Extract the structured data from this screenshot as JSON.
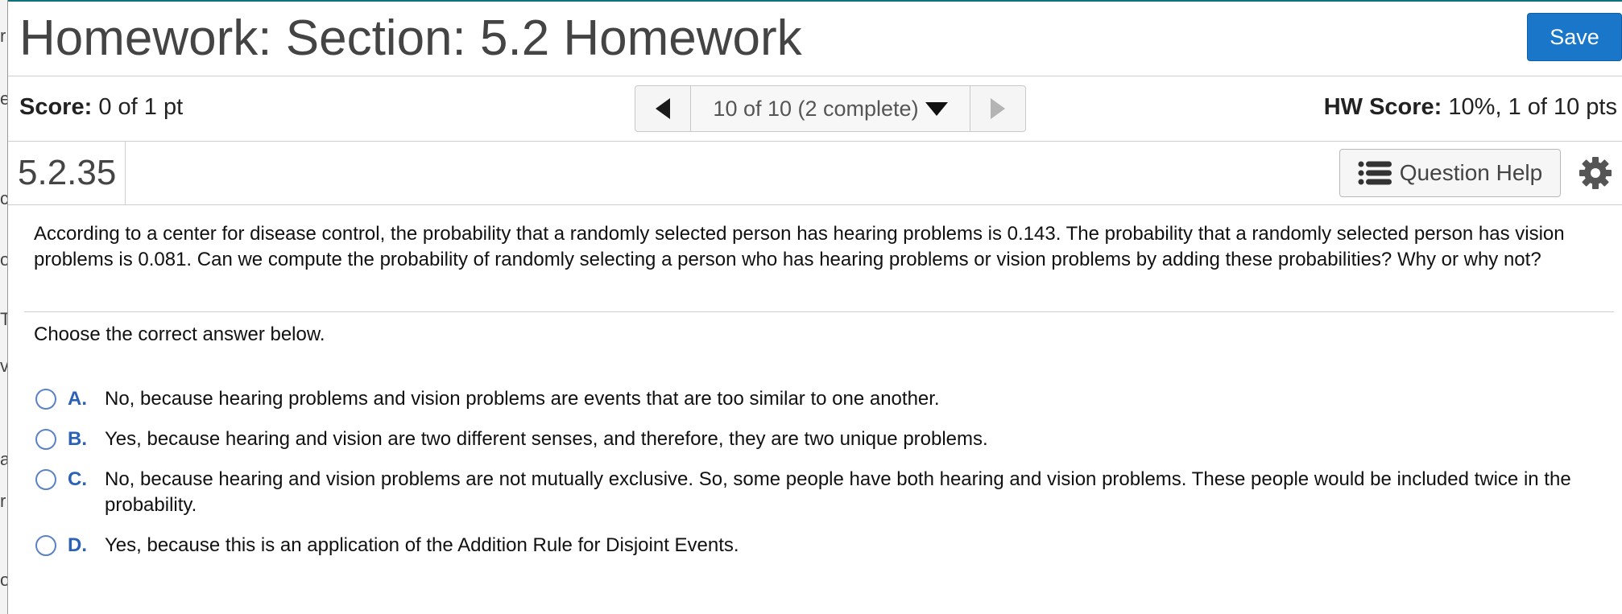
{
  "header": {
    "title": "Homework: Section: 5.2 Homework",
    "save_label": "Save"
  },
  "score": {
    "label": "Score:",
    "value": "0 of 1 pt"
  },
  "navigation": {
    "position": "10 of 10 (2 complete)"
  },
  "hw_score": {
    "label": "HW Score:",
    "value": "10%, 1 of 10 pts"
  },
  "question_bar": {
    "number": "5.2.35",
    "help_label": "Question Help"
  },
  "question": {
    "text": "According to a center for disease control, the probability that a randomly selected person has hearing problems is 0.143. The probability that a randomly selected person has vision problems is 0.081. Can we compute the probability of randomly selecting a person who has hearing problems or vision problems by adding these probabilities? Why or why not?",
    "instruction": "Choose the correct answer below."
  },
  "options": [
    {
      "letter": "A.",
      "text": "No, because hearing problems and vision problems are events that are too similar to one another."
    },
    {
      "letter": "B.",
      "text": "Yes, because hearing and vision are two different senses, and therefore, they are two unique problems."
    },
    {
      "letter": "C.",
      "text": "No, because hearing and vision problems are not mutually exclusive. So, some people have both hearing and vision problems. These people would be included twice in the probability."
    },
    {
      "letter": "D.",
      "text": "Yes, because this is an application of the Addition Rule for Disjoint Events."
    }
  ],
  "colors": {
    "accent": "#1976c9",
    "option_letter": "#2b62b8",
    "top_border": "#0e6f7f"
  },
  "icons": {
    "prev": "triangle-left-icon",
    "next": "triangle-right-icon",
    "dropdown": "caret-down-icon",
    "help": "list-icon",
    "settings": "gear-icon"
  }
}
